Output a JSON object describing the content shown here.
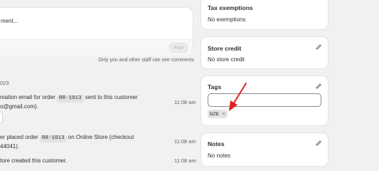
{
  "timeline": {
    "comment_placeholder": "ment...",
    "post_label": "Post",
    "staff_note": "Only you and other staff can see comments",
    "date": "023",
    "events": [
      {
        "line1_before": "mation email for order",
        "order": "R8-1013",
        "line1_after": "sent to this customer",
        "line2": "o@gmail.com).",
        "time": "11:08 am"
      },
      {
        "line1_before": "er placed order",
        "order": "R8-1013",
        "line1_after": "on Online Store (checkout",
        "line2": "44041).",
        "time": "11:08 am"
      },
      {
        "line1": "tore created this customer.",
        "time": "11:08 am"
      }
    ]
  },
  "sidebar": {
    "tax": {
      "title": "Tax exemptions",
      "value": "No exemptions"
    },
    "store_credit": {
      "title": "Store credit",
      "value": "No store credit"
    },
    "tags": {
      "title": "Tags",
      "input_value": "",
      "items": [
        {
          "label": "b2b",
          "remove": "×"
        }
      ]
    },
    "notes": {
      "title": "Notes",
      "value": "No notes"
    }
  },
  "colors": {
    "background": "#f1f1f1",
    "card": "#ffffff",
    "annotation_arrow": "#e02020"
  },
  "icons": {
    "edit": "pencil-icon",
    "tag_remove": "close-icon",
    "annotation": "red-arrow"
  }
}
